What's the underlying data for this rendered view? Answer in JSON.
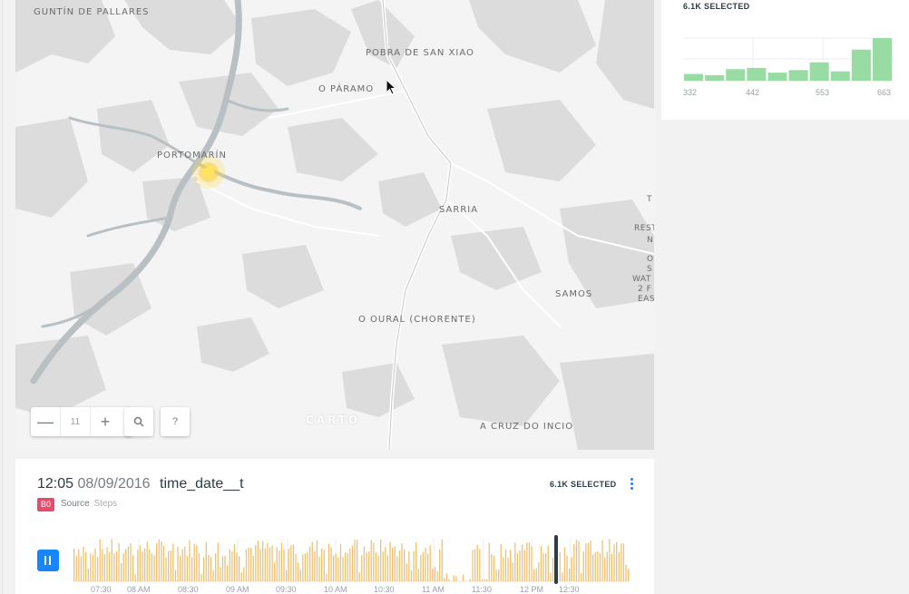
{
  "map": {
    "labels": [
      "GUNTÍN DE PALLARES",
      "POBRA DE SAN XIAO",
      "O PÁRAMO",
      "PORTOMARÍN",
      "SARRIA",
      "SAMOS",
      "O OURAL (CHORENTE)",
      "A CRUZ DO INCIO"
    ],
    "edge_labels": [
      "T",
      "REST",
      "N",
      "O",
      "S",
      "WAT",
      "2 F",
      "EAS"
    ],
    "attribution": "CARTO",
    "zoom": {
      "level": "11",
      "minus": "—",
      "plus": "+"
    },
    "search_icon": "search-icon",
    "help_label": "?",
    "hotspot_color": "#ffcc00"
  },
  "side_histogram": {
    "selected": "6.1K SELECTED",
    "bar_color": "#98dca4",
    "chart_data": {
      "type": "bar",
      "values": [
        0.16,
        0.13,
        0.27,
        0.3,
        0.19,
        0.25,
        0.43,
        0.22,
        0.73,
        1.0
      ],
      "ticks": [
        "332",
        "442",
        "553",
        "663"
      ],
      "xlim": [
        332,
        663
      ]
    }
  },
  "time_series": {
    "time": "12:05",
    "date": "08/09/2016",
    "column": "time_date__t",
    "selected": "6.1K SELECTED",
    "layer_badge": "B0",
    "source_label": "Source",
    "source_name": "Steps",
    "bar_color": "#f0c070",
    "playhead_color": "#2e3c43",
    "chart_data": {
      "type": "bar",
      "ticks": [
        "07:30",
        "08 AM",
        "08:30",
        "09 AM",
        "09:30",
        "10 AM",
        "10:30",
        "11 AM",
        "11:30",
        "12 PM",
        "12:30"
      ]
    }
  }
}
